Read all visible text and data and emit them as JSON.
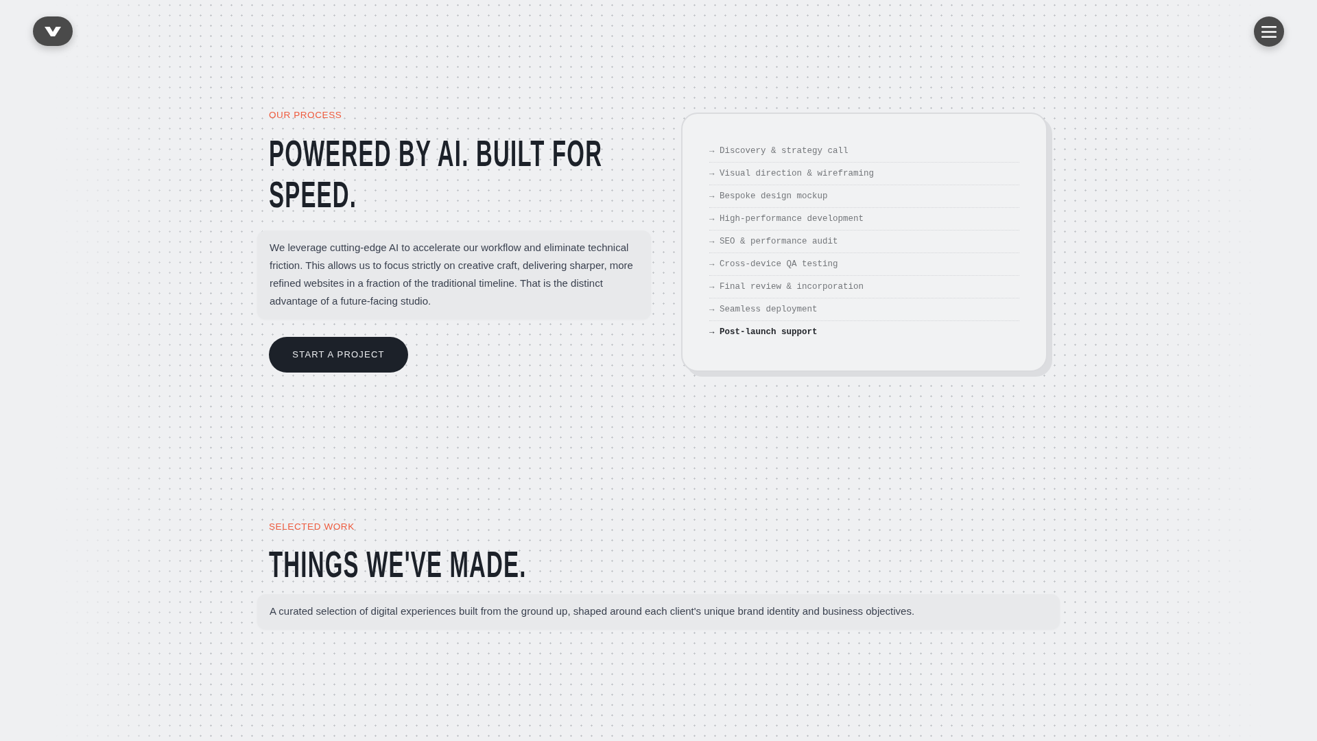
{
  "process": {
    "label": "OUR PROCESS",
    "heading": "POWERED BY AI. BUILT FOR SPEED.",
    "description": "We leverage cutting-edge AI to accelerate our workflow and eliminate technical friction. This allows us to focus strictly on creative craft, delivering sharper, more refined websites in a fraction of the traditional timeline. That is the distinct advantage of a future-facing studio.",
    "button": "START A PROJECT",
    "steps": [
      {
        "label": "→ Discovery & strategy call",
        "highlighted": false
      },
      {
        "label": "→ Visual direction & wireframing",
        "highlighted": false
      },
      {
        "label": "→ Bespoke design mockup",
        "highlighted": false
      },
      {
        "label": "→ High-performance development",
        "highlighted": false
      },
      {
        "label": "→ SEO & performance audit",
        "highlighted": false
      },
      {
        "label": "→ Cross-device QA testing",
        "highlighted": false
      },
      {
        "label": "→ Final review & incorporation",
        "highlighted": false
      },
      {
        "label": "→ Seamless deployment",
        "highlighted": false
      },
      {
        "label": "→ Post-launch support",
        "highlighted": true
      }
    ]
  },
  "work": {
    "label": "SELECTED WORK",
    "heading": "THINGS WE'VE MADE.",
    "description": "A curated selection of digital experiences built from the ground up, shaped around each client's unique brand identity and business objectives."
  }
}
